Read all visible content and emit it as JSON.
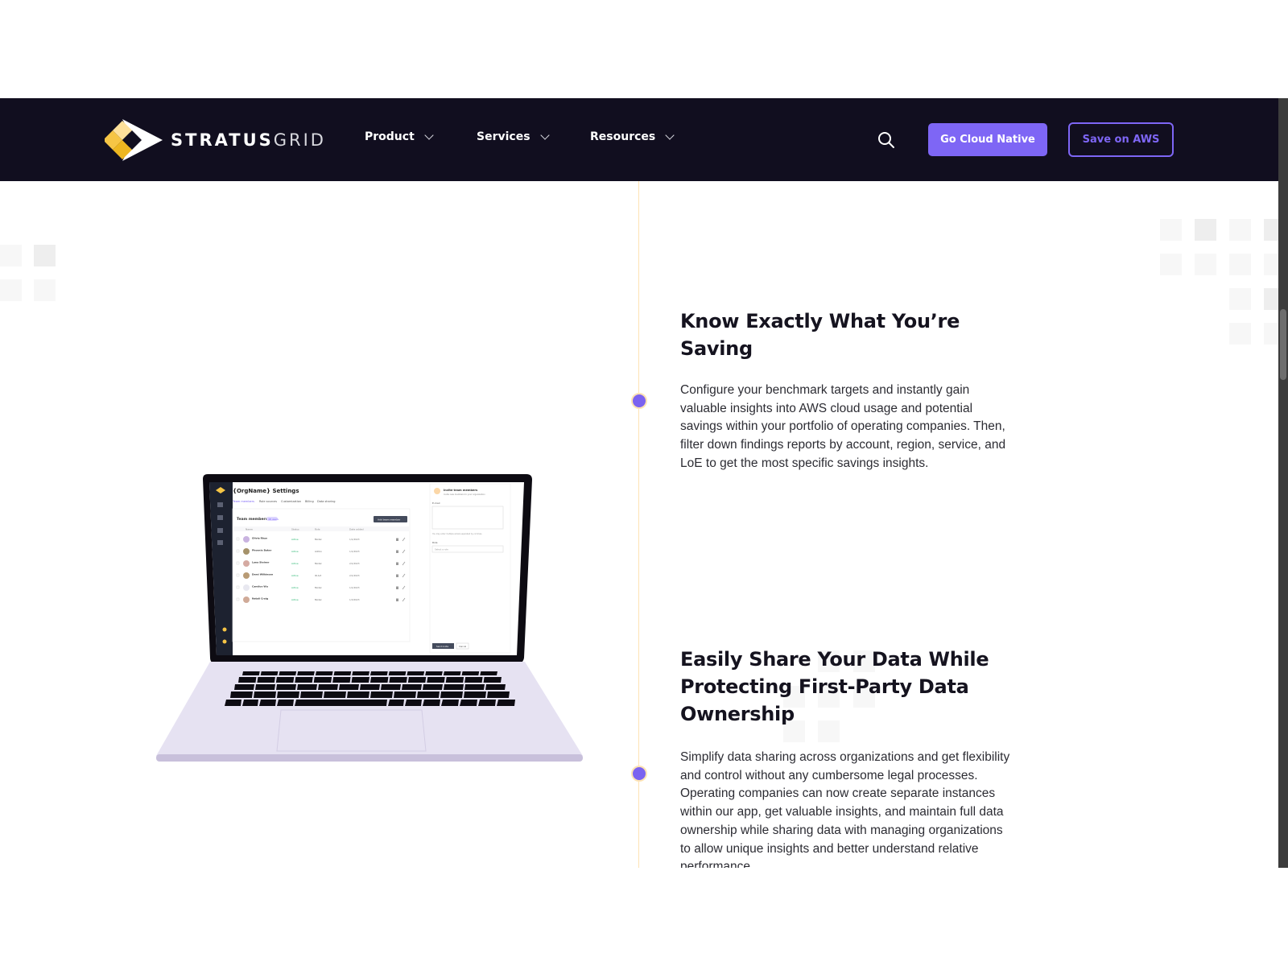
{
  "navbar": {
    "brand": {
      "bold": "STRATUS",
      "light": "GRID"
    },
    "menu": [
      {
        "label": "Product"
      },
      {
        "label": "Services"
      },
      {
        "label": "Resources"
      }
    ],
    "search_icon": "search-icon",
    "primary_button": "Go Cloud Native",
    "outline_button": "Save on AWS",
    "colors": {
      "background": "#110e1f",
      "accent": "#7e66f5"
    }
  },
  "laptop_screen": {
    "title": "{OrgName} Settings",
    "tabs": [
      "Team members",
      "Role sources",
      "Customization",
      "Billing",
      "Data sharing"
    ],
    "section": "Team members",
    "badge": "48 users",
    "add_button": "Add team member",
    "columns": [
      "Name",
      "Status",
      "Role",
      "Date added"
    ],
    "rows": [
      {
        "name": "Olivia Rhye",
        "status": "Active",
        "role": "Model",
        "date": "1/1/2023",
        "avatar": "#c9b3e0"
      },
      {
        "name": "Phoenix Baker",
        "status": "Active",
        "role": "Admin",
        "date": "1/1/2023",
        "avatar": "#a5926a"
      },
      {
        "name": "Lana Steiner",
        "status": "Active",
        "role": "Model",
        "date": "2/1/2023",
        "avatar": "#d5aaa2"
      },
      {
        "name": "Demi Wilkinson",
        "status": "Active",
        "role": "IR Act",
        "date": "2/1/2023",
        "avatar": "#b89b75"
      },
      {
        "name": "Candice Wu",
        "status": "Active",
        "role": "Model",
        "date": "1/1/2023",
        "avatar": "#e8e8f0"
      },
      {
        "name": "Natali Craig",
        "status": "Active",
        "role": "Model",
        "date": "1/3/2023",
        "avatar": "#d0aa98"
      }
    ],
    "panel": {
      "title": "Invite team members",
      "subtitle": "Invite new members to your organization",
      "email_label": "E-mail",
      "hint": "You may enter multiple emails separated by commas.",
      "role_label": "Role",
      "role_placeholder": "Select a role",
      "send_button": "Send invite",
      "cancel_button": "Cancel"
    }
  },
  "features": [
    {
      "title": "Know Exactly What You’re Saving",
      "body": "Configure your benchmark targets and instantly gain valuable insights into AWS cloud usage and potential savings within your portfolio of operating companies. Then, filter down findings reports by account, region, service, and LoE to get the most specific savings insights."
    },
    {
      "title": "Easily Share Your Data While Protecting First-Party Data Ownership",
      "body": "Simplify data sharing across organizations and get flexibility and control without any cumbersome legal processes. Operating companies can now create separate instances within our app, get valuable insights, and maintain full data ownership while sharing data with managing organizations to allow unique insights and better understand relative performance."
    }
  ]
}
